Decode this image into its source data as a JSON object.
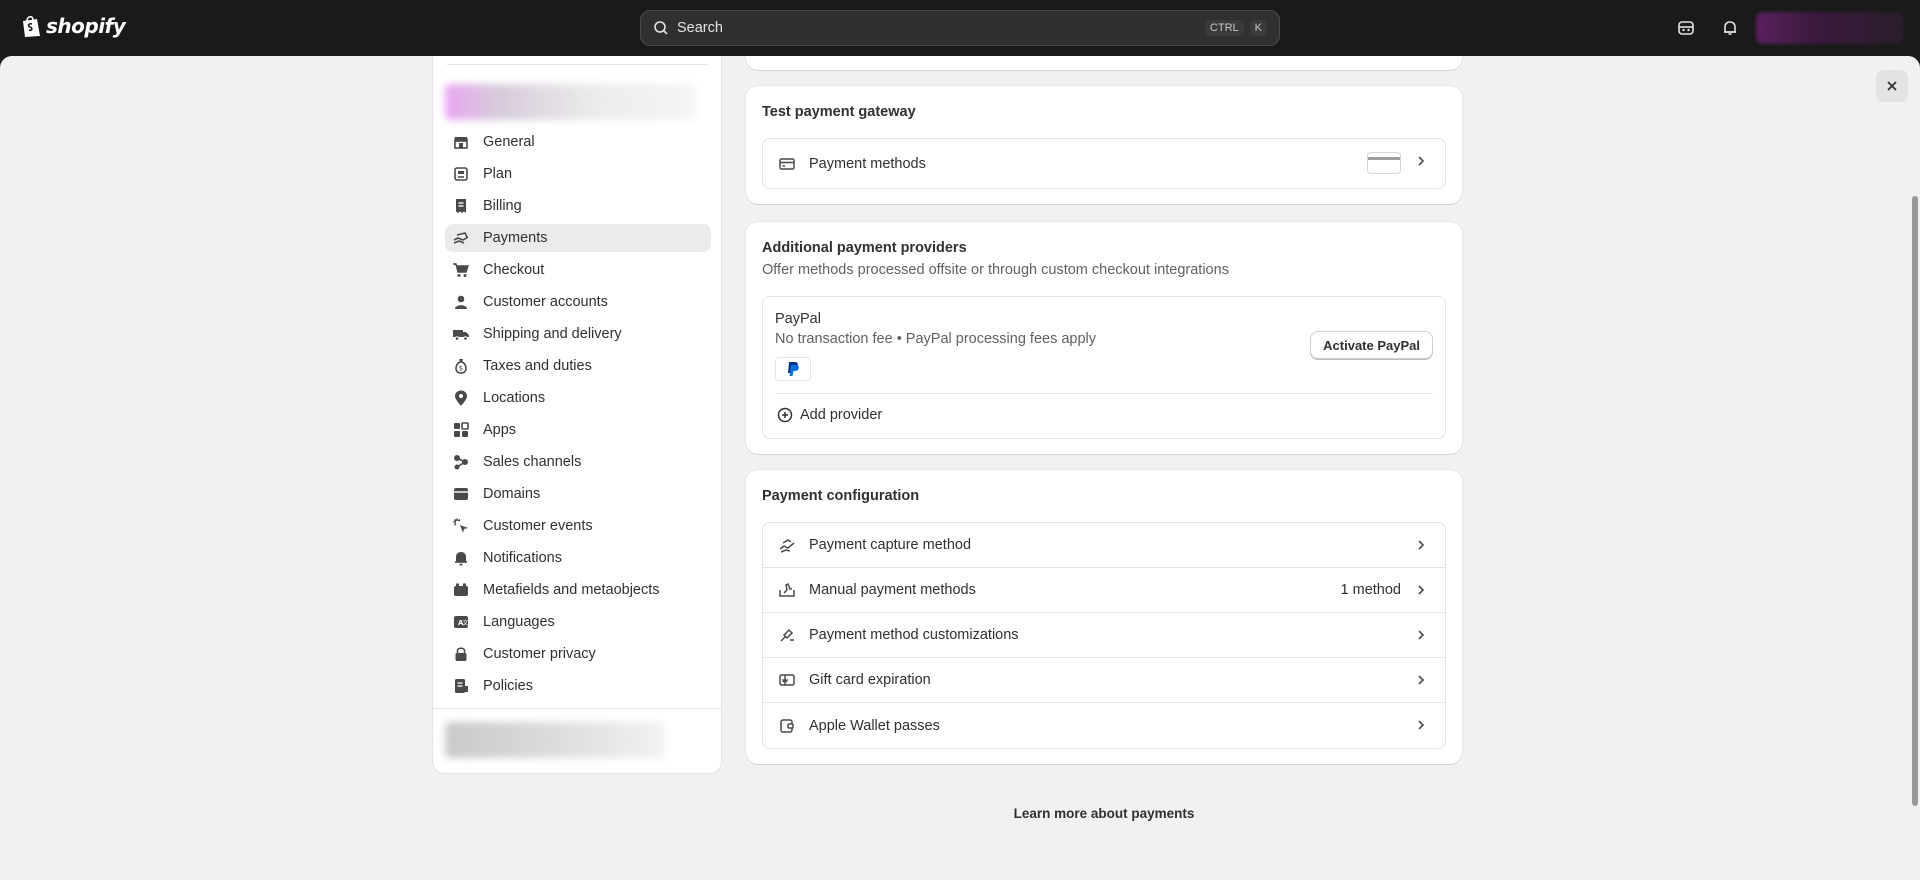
{
  "brand": {
    "name": "shopify"
  },
  "search": {
    "placeholder": "Search",
    "shortcut": [
      "CTRL",
      "K"
    ]
  },
  "sidebar": {
    "items": [
      {
        "label": "General",
        "icon": "store-icon"
      },
      {
        "label": "Plan",
        "icon": "plan-icon"
      },
      {
        "label": "Billing",
        "icon": "receipt-icon"
      },
      {
        "label": "Payments",
        "icon": "cash-hand-icon",
        "active": true
      },
      {
        "label": "Checkout",
        "icon": "cart-icon"
      },
      {
        "label": "Customer accounts",
        "icon": "person-icon"
      },
      {
        "label": "Shipping and delivery",
        "icon": "truck-icon"
      },
      {
        "label": "Taxes and duties",
        "icon": "money-bag-icon"
      },
      {
        "label": "Locations",
        "icon": "location-icon"
      },
      {
        "label": "Apps",
        "icon": "apps-icon"
      },
      {
        "label": "Sales channels",
        "icon": "channels-icon"
      },
      {
        "label": "Domains",
        "icon": "globe-icon"
      },
      {
        "label": "Customer events",
        "icon": "cursor-icon"
      },
      {
        "label": "Notifications",
        "icon": "bell-icon"
      },
      {
        "label": "Metafields and metaobjects",
        "icon": "metafields-icon"
      },
      {
        "label": "Languages",
        "icon": "language-icon"
      },
      {
        "label": "Customer privacy",
        "icon": "lock-icon"
      },
      {
        "label": "Policies",
        "icon": "document-icon"
      }
    ]
  },
  "test_gateway": {
    "title": "Test payment gateway",
    "row": {
      "label": "Payment methods"
    }
  },
  "additional_providers": {
    "title": "Additional payment providers",
    "subtitle": "Offer methods processed offsite or through custom checkout integrations",
    "paypal": {
      "name": "PayPal",
      "description": "No transaction fee • PayPal processing fees apply",
      "button": "Activate PayPal"
    },
    "add_provider": "Add provider"
  },
  "payment_configuration": {
    "title": "Payment configuration",
    "rows": [
      {
        "label": "Payment capture method",
        "icon": "capture-icon",
        "trail": ""
      },
      {
        "label": "Manual payment methods",
        "icon": "manual-payment-icon",
        "trail": "1 method"
      },
      {
        "label": "Payment method customizations",
        "icon": "customize-icon",
        "trail": ""
      },
      {
        "label": "Gift card expiration",
        "icon": "gift-card-icon",
        "trail": ""
      },
      {
        "label": "Apple Wallet passes",
        "icon": "wallet-icon",
        "trail": ""
      }
    ]
  },
  "footer": {
    "learn_more": "Learn more about payments"
  },
  "colors": {
    "topbar": "#1a1a1a",
    "background": "#f1f1f1",
    "active_nav": "#ebebeb",
    "paypal_blue": "#003087"
  }
}
